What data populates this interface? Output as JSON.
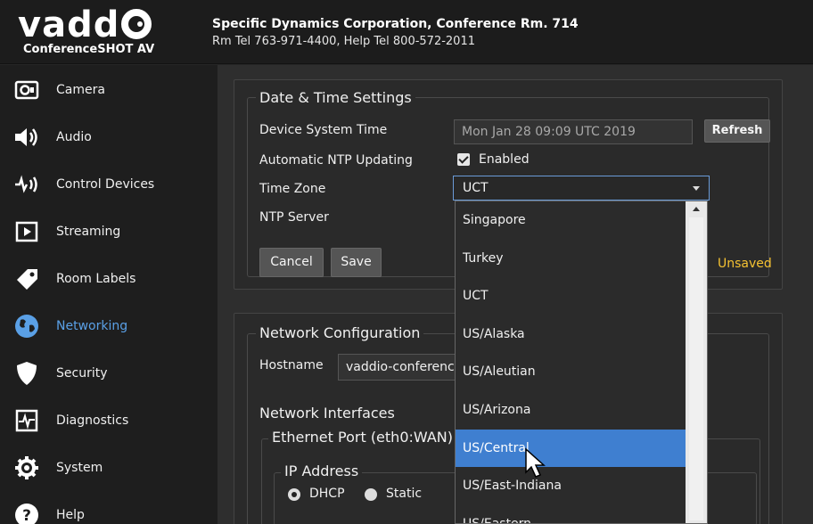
{
  "header": {
    "logo_text": "vadd",
    "product": "ConferenceSHOT AV",
    "line1": "Specific Dynamics Corporation, Conference Rm. 714",
    "line2": "Rm Tel 763-971-4400, Help Tel 800-572-2011"
  },
  "sidebar": {
    "items": [
      {
        "label": "Camera",
        "icon": "camera-icon"
      },
      {
        "label": "Audio",
        "icon": "speaker-icon"
      },
      {
        "label": "Control Devices",
        "icon": "control-devices-icon"
      },
      {
        "label": "Streaming",
        "icon": "play-icon"
      },
      {
        "label": "Room Labels",
        "icon": "tag-icon"
      },
      {
        "label": "Networking",
        "icon": "globe-icon",
        "active": true
      },
      {
        "label": "Security",
        "icon": "shield-icon"
      },
      {
        "label": "Diagnostics",
        "icon": "pulse-icon"
      },
      {
        "label": "System",
        "icon": "gear-icon"
      },
      {
        "label": "Help",
        "icon": "help-icon"
      }
    ]
  },
  "datetime": {
    "legend": "Date & Time Settings",
    "device_time_label": "Device System Time",
    "device_time_value": "Mon Jan 28 09:09 UTC 2019",
    "refresh_label": "Refresh",
    "ntp_label": "Automatic NTP Updating",
    "ntp_enabled_label": "Enabled",
    "timezone_label": "Time Zone",
    "timezone_value": "UCT",
    "ntp_server_label": "NTP Server",
    "cancel_label": "Cancel",
    "save_label": "Save",
    "unsaved_label": "Unsaved"
  },
  "timezone_options": [
    "Singapore",
    "Turkey",
    "UCT",
    "US/Alaska",
    "US/Aleutian",
    "US/Arizona",
    "US/Central",
    "US/East-Indiana",
    "US/Eastern"
  ],
  "timezone_selected_index": 6,
  "network": {
    "legend": "Network Configuration",
    "hostname_label": "Hostname",
    "hostname_value": "vaddio-conference",
    "interfaces_label": "Network Interfaces",
    "ethernet_legend": "Ethernet Port (eth0:WAN)",
    "ip_legend": "IP Address",
    "dhcp_label": "DHCP",
    "static_label": "Static"
  },
  "colors": {
    "accent": "#3f7fd0",
    "active_nav": "#5aa0e6",
    "unsaved": "#f5c232"
  }
}
